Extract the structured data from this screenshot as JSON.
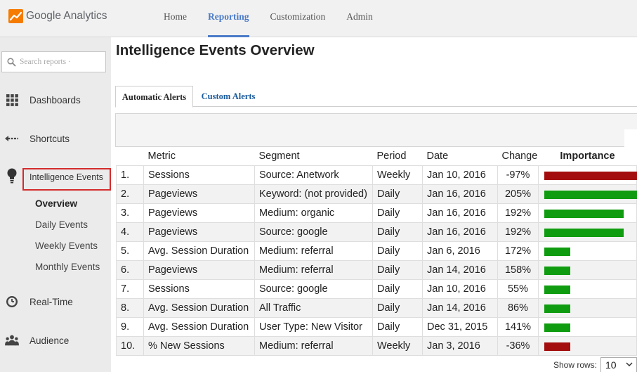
{
  "app": {
    "name": "Google Analytics"
  },
  "topnav": [
    "Home",
    "Reporting",
    "Customization",
    "Admin"
  ],
  "topnav_active": "Reporting",
  "sidebar": {
    "search_placeholder": "Search reports ·",
    "items": {
      "dashboards": "Dashboards",
      "shortcuts": "Shortcuts",
      "intelligence": "Intelligence Events",
      "realtime": "Real-Time",
      "audience": "Audience"
    },
    "sub_items": [
      "Overview",
      "Daily Events",
      "Weekly Events",
      "Monthly Events"
    ],
    "sub_active": "Overview"
  },
  "page": {
    "title": "Intelligence Events Overview",
    "tabs": [
      "Automatic Alerts",
      "Custom Alerts"
    ],
    "active_tab": "Automatic Alerts"
  },
  "table": {
    "headers": {
      "num": "",
      "metric": "Metric",
      "segment": "Segment",
      "period": "Period",
      "date": "Date",
      "change": "Change",
      "importance": "Importance"
    },
    "rows": [
      {
        "num": "1.",
        "metric": "Sessions",
        "segment": "Source: Anetwork",
        "period": "Weekly",
        "date": "Jan 10, 2016",
        "change": "-97%",
        "importance": 1.0,
        "color": "#a30d0d"
      },
      {
        "num": "2.",
        "metric": "Pageviews",
        "segment": "Keyword: (not provided)",
        "period": "Daily",
        "date": "Jan 16, 2016",
        "change": "205%",
        "importance": 1.0,
        "color": "#109c10"
      },
      {
        "num": "3.",
        "metric": "Pageviews",
        "segment": "Medium: organic",
        "period": "Daily",
        "date": "Jan 16, 2016",
        "change": "192%",
        "importance": 0.85,
        "color": "#109c10"
      },
      {
        "num": "4.",
        "metric": "Pageviews",
        "segment": "Source: google",
        "period": "Daily",
        "date": "Jan 16, 2016",
        "change": "192%",
        "importance": 0.85,
        "color": "#109c10"
      },
      {
        "num": "5.",
        "metric": "Avg. Session Duration",
        "segment": "Medium: referral",
        "period": "Daily",
        "date": "Jan 6, 2016",
        "change": "172%",
        "importance": 0.28,
        "color": "#109c10"
      },
      {
        "num": "6.",
        "metric": "Pageviews",
        "segment": "Medium: referral",
        "period": "Daily",
        "date": "Jan 14, 2016",
        "change": "158%",
        "importance": 0.28,
        "color": "#109c10"
      },
      {
        "num": "7.",
        "metric": "Sessions",
        "segment": "Source: google",
        "period": "Daily",
        "date": "Jan 10, 2016",
        "change": "55%",
        "importance": 0.28,
        "color": "#109c10"
      },
      {
        "num": "8.",
        "metric": "Avg. Session Duration",
        "segment": "All Traffic",
        "period": "Daily",
        "date": "Jan 14, 2016",
        "change": "86%",
        "importance": 0.28,
        "color": "#109c10"
      },
      {
        "num": "9.",
        "metric": "Avg. Session Duration",
        "segment": "User Type: New Visitor",
        "period": "Daily",
        "date": "Dec 31, 2015",
        "change": "141%",
        "importance": 0.28,
        "color": "#109c10"
      },
      {
        "num": "10.",
        "metric": "% New Sessions",
        "segment": "Medium: referral",
        "period": "Weekly",
        "date": "Jan 3, 2016",
        "change": "-36%",
        "importance": 0.28,
        "color": "#a30d0d"
      }
    ]
  },
  "footer": {
    "show_rows_label": "Show rows:",
    "show_rows_value": "10"
  }
}
